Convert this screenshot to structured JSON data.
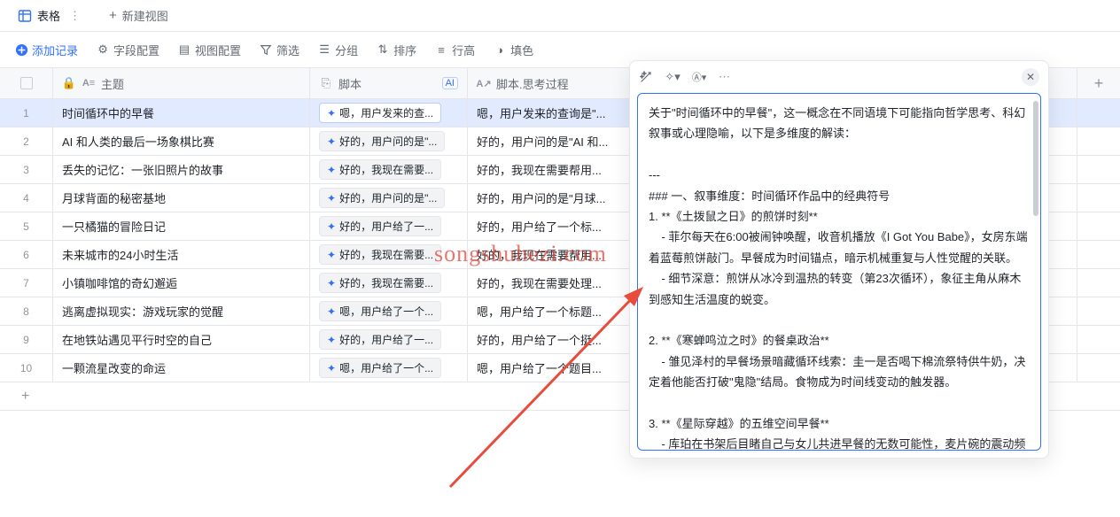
{
  "viewTabs": {
    "current": "表格",
    "new": "新建视图"
  },
  "toolbar": {
    "addRecord": "添加记录",
    "fieldConfig": "字段配置",
    "viewConfig": "视图配置",
    "filter": "筛选",
    "group": "分组",
    "sort": "排序",
    "rowHeight": "行高",
    "fill": "填色"
  },
  "columns": {
    "topic": "主题",
    "script": "脚本",
    "scriptThought": "脚本.思考过程",
    "aiBadge": "AI"
  },
  "rows": [
    {
      "idx": "1",
      "topic": "时间循环中的早餐",
      "script": "嗯，用户发来的查...",
      "thought": "嗯，用户发来的查询是\"..."
    },
    {
      "idx": "2",
      "topic": "AI 和人类的最后一场象棋比赛",
      "script": "好的，用户问的是\"...",
      "thought": "好的，用户问的是\"AI 和..."
    },
    {
      "idx": "3",
      "topic": "丢失的记忆：一张旧照片的故事",
      "script": "好的，我现在需要...",
      "thought": "好的，我现在需要帮用..."
    },
    {
      "idx": "4",
      "topic": "月球背面的秘密基地",
      "script": "好的，用户问的是\"...",
      "thought": "好的，用户问的是\"月球..."
    },
    {
      "idx": "5",
      "topic": "一只橘猫的冒险日记",
      "script": "好的，用户给了一...",
      "thought": "好的，用户给了一个标..."
    },
    {
      "idx": "6",
      "topic": "未来城市的24小时生活",
      "script": "好的，我现在需要...",
      "thought": "好的，我现在需要帮用..."
    },
    {
      "idx": "7",
      "topic": "小镇咖啡馆的奇幻邂逅",
      "script": "好的，我现在需要...",
      "thought": "好的，我现在需要处理..."
    },
    {
      "idx": "8",
      "topic": "逃离虚拟现实：游戏玩家的觉醒",
      "script": "嗯，用户给了一个...",
      "thought": "嗯，用户给了一个标题..."
    },
    {
      "idx": "9",
      "topic": "在地铁站遇见平行时空的自己",
      "script": "好的，用户给了一...",
      "thought": "好的，用户给了一个挺..."
    },
    {
      "idx": "10",
      "topic": "一颗流星改变的命运",
      "script": "嗯，用户给了一个...",
      "thought": "嗯，用户给了一个题目..."
    }
  ],
  "panel": {
    "content": "关于\"时间循环中的早餐\"，这一概念在不同语境下可能指向哲学思考、科幻叙事或心理隐喻，以下是多维度的解读：\n\n---\n### 一、叙事维度：时间循环作品中的经典符号\n1. **《土拨鼠之日》的煎饼时刻**\n    - 菲尔每天在6:00被闹钟唤醒，收音机播放《I Got You Babe》，女房东端着蓝莓煎饼敲门。早餐成为时间锚点，暗示机械重复与人性觉醒的关联。\n    - 细节深意：煎饼从冰冷到温热的转变（第23次循环），象征主角从麻木到感知生活温度的蜕变。\n\n2. **《寒蝉鸣泣之时》的餐桌政治**\n    - 雏见泽村的早餐场景暗藏循环线索：圭一是否喝下棉流祭特供牛奶，决定着他能否打破\"鬼隐\"结局。食物成为时间线变动的触发器。\n\n3. **《星际穿越》的五维空间早餐**\n    - 库珀在书架后目睹自己与女儿共进早餐的无数可能性，麦片碗的震动频率传递二进制密码。此处早餐承载着跨越时空的信息载体功能。"
  },
  "watermark": "songshuhezi.com"
}
